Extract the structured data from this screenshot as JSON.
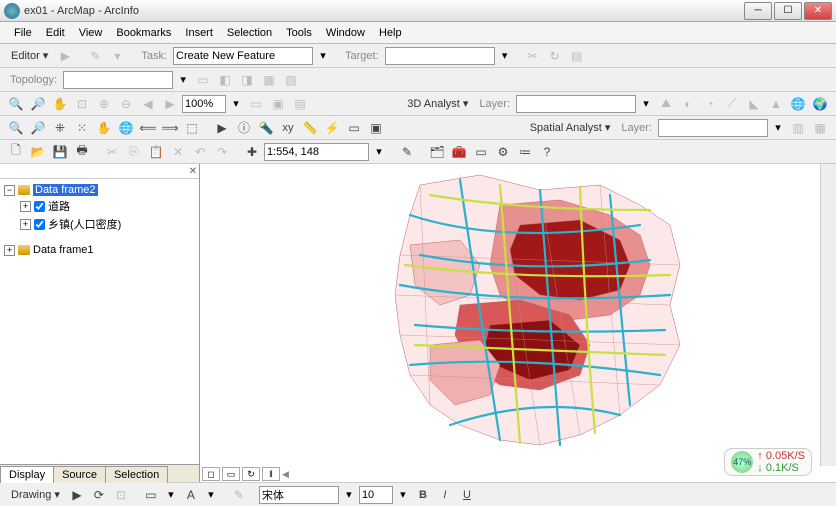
{
  "window": {
    "title": "ex01 - ArcMap - ArcInfo"
  },
  "menubar": [
    "File",
    "Edit",
    "View",
    "Bookmarks",
    "Insert",
    "Selection",
    "Tools",
    "Window",
    "Help"
  ],
  "editor": {
    "label": "Editor",
    "task_label": "Task:",
    "task_value": "Create New Feature",
    "target_label": "Target:"
  },
  "topology": {
    "label": "Topology:"
  },
  "zoom_pct": "100%",
  "analyst3d": {
    "label": "3D Analyst",
    "layer_label": "Layer:"
  },
  "spatial": {
    "label": "Spatial Analyst",
    "layer_label": "Layer:"
  },
  "scale": "1:554, 148",
  "toc": {
    "frames": [
      {
        "name": "Data frame2",
        "expanded": true,
        "selected": true,
        "layers": [
          {
            "name": "道路",
            "checked": true
          },
          {
            "name": "乡镇(人口密度)",
            "checked": true
          }
        ]
      },
      {
        "name": "Data frame1",
        "expanded": false,
        "selected": false,
        "layers": []
      }
    ],
    "tabs": [
      "Display",
      "Source",
      "Selection"
    ],
    "active_tab": "Display"
  },
  "net": {
    "pct": "47%",
    "up": "0.05K/S",
    "down": "0.1K/S"
  },
  "drawing": {
    "label": "Drawing",
    "font": "宋体",
    "size": "10"
  }
}
